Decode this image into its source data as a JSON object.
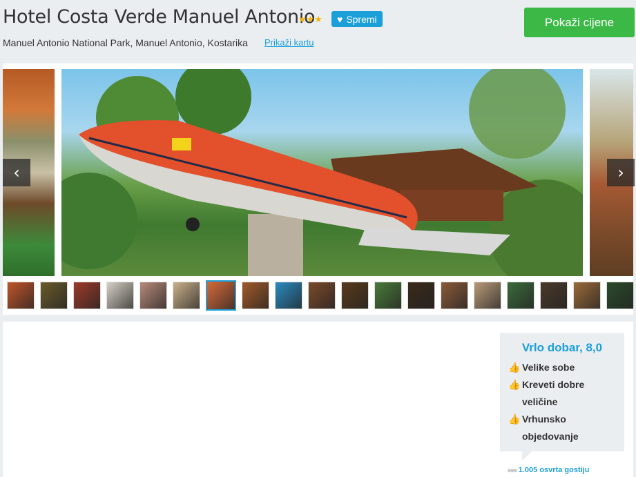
{
  "header": {
    "hotel_name": "Hotel Costa Verde Manuel Antonio",
    "stars": "★★★",
    "save_label": "Spremi",
    "address": "Manuel Antonio National Park, Manuel Antonio, Kostarika",
    "map_link": "Prikaži kartu",
    "price_button": "Pokaži cijene"
  },
  "gallery": {
    "prev_icon": "‹",
    "next_icon": "›",
    "thumbnail_count": 19,
    "active_thumbnail": 7,
    "thumbnail_colors": [
      "#c0542a",
      "#6a5a2a",
      "#9b3b2a",
      "#d6cfc4",
      "#b78a7a",
      "#c9b08a",
      "#d56a3a",
      "#a05a2a",
      "#2a8ac0",
      "#7a4a2a",
      "#5a3a1a",
      "#4a7a3a",
      "#3a2a1a",
      "#8a5a3a",
      "#b89a7a",
      "#3a6a3a",
      "#4a3a2a",
      "#9a6a3a",
      "#2a4a2a"
    ]
  },
  "reviews": {
    "title": "Vrlo dobar, 8,0",
    "pros": [
      "Velike sobe",
      "Kreveti dobre veličine",
      "Vrhunsko objedovanje"
    ],
    "count_label": "1.005 osvrta gostiju"
  },
  "colors": {
    "accent": "#1a9fd9",
    "price_button": "#3cb846",
    "stars": "#f5b400"
  }
}
